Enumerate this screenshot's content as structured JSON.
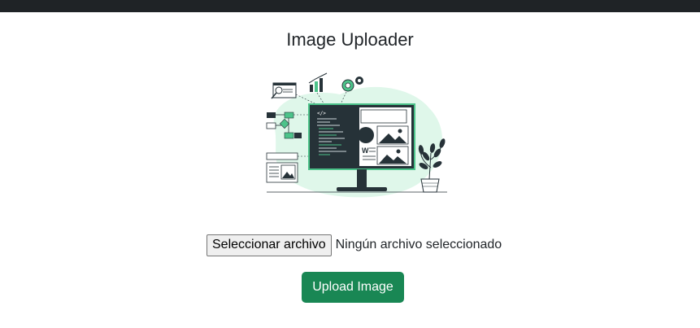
{
  "header": {
    "title": "Image Uploader"
  },
  "illustration": {
    "icon": "monitor-developer-illustration",
    "code_tag": "</>",
    "doc_letter": "W"
  },
  "file_input": {
    "button_label": "Seleccionar archivo",
    "status_text": "Ningún archivo seleccionado"
  },
  "actions": {
    "upload_label": "Upload Image"
  },
  "colors": {
    "topbar": "#1f2326",
    "accent_green": "#198754",
    "illustration_mint": "#dff7ea",
    "illustration_green": "#4cc38a",
    "illustration_dark": "#263238"
  }
}
